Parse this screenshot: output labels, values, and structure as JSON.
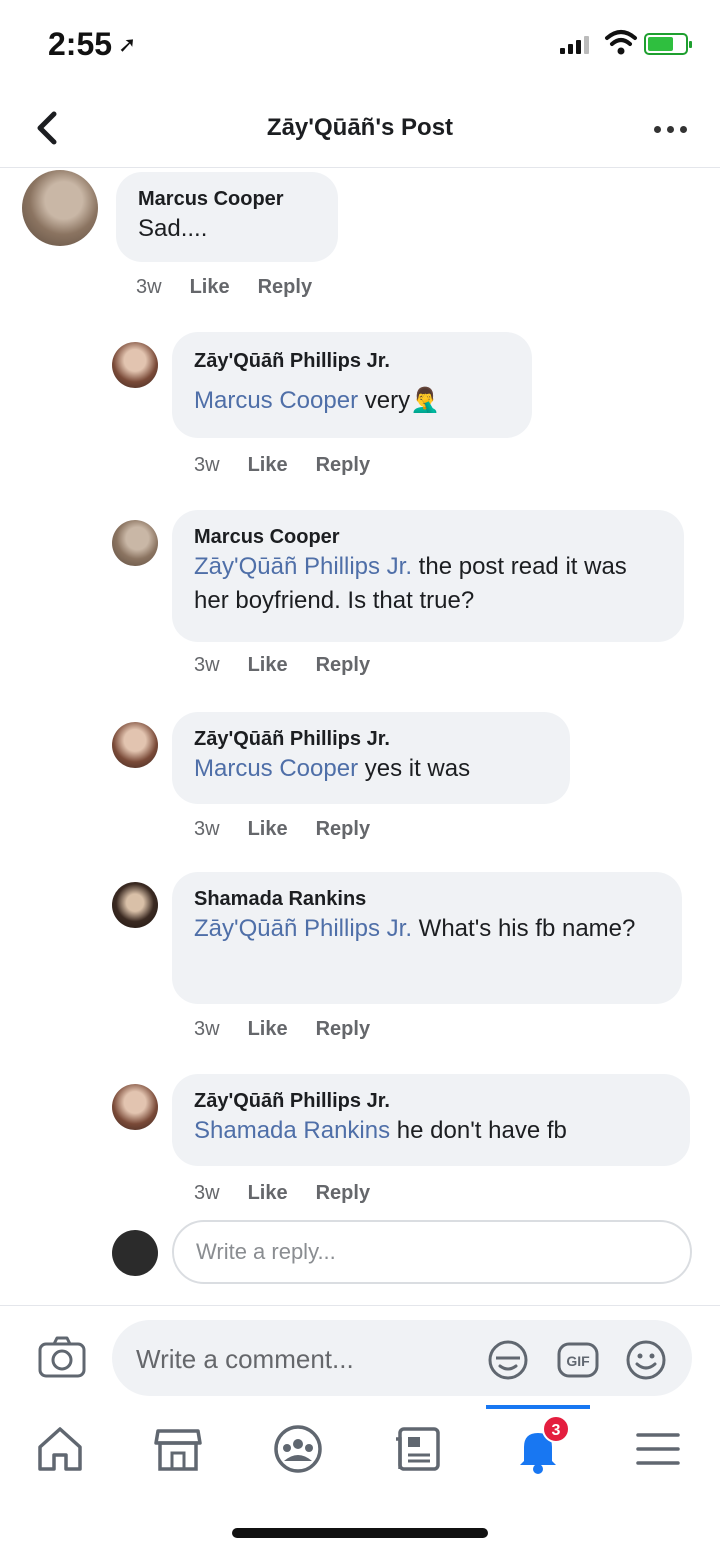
{
  "status_bar": {
    "time": "2:55"
  },
  "header": {
    "title": "Zāy'Qūāñ's Post"
  },
  "comments": [
    {
      "author": "Marcus Cooper",
      "mention": "",
      "text": "Sad....",
      "time": "3w",
      "like": "Like",
      "reply": "Reply"
    },
    {
      "author": "Zāy'Qūāñ Phillips Jr.",
      "mention": "Marcus Cooper",
      "text": " very🤦‍♂️",
      "time": "3w",
      "like": "Like",
      "reply": "Reply"
    },
    {
      "author": "Marcus Cooper",
      "mention": "Zāy'Qūāñ Phillips Jr.",
      "text": " the post read it was her boyfriend. Is that true?",
      "time": "3w",
      "like": "Like",
      "reply": "Reply"
    },
    {
      "author": "Zāy'Qūāñ Phillips Jr.",
      "mention": "Marcus Cooper",
      "text": " yes it was",
      "time": "3w",
      "like": "Like",
      "reply": "Reply"
    },
    {
      "author": "Shamada Rankins",
      "mention": "Zāy'Qūāñ Phillips Jr.",
      "text": " What's his fb name?",
      "time": "3w",
      "like": "Like",
      "reply": "Reply"
    },
    {
      "author": "Zāy'Qūāñ Phillips Jr.",
      "mention": "Shamada Rankins",
      "text": " he don't have fb",
      "time": "3w",
      "like": "Like",
      "reply": "Reply"
    }
  ],
  "reply_input": {
    "placeholder": "Write a reply..."
  },
  "composer": {
    "placeholder": "Write a comment...",
    "gif_label": "GIF"
  },
  "tabbar": {
    "notifications_badge": "3"
  },
  "colors": {
    "accent": "#1877f2",
    "mention": "#4f6fa8",
    "bubble": "#f0f2f5",
    "badge": "#e41e3f"
  }
}
